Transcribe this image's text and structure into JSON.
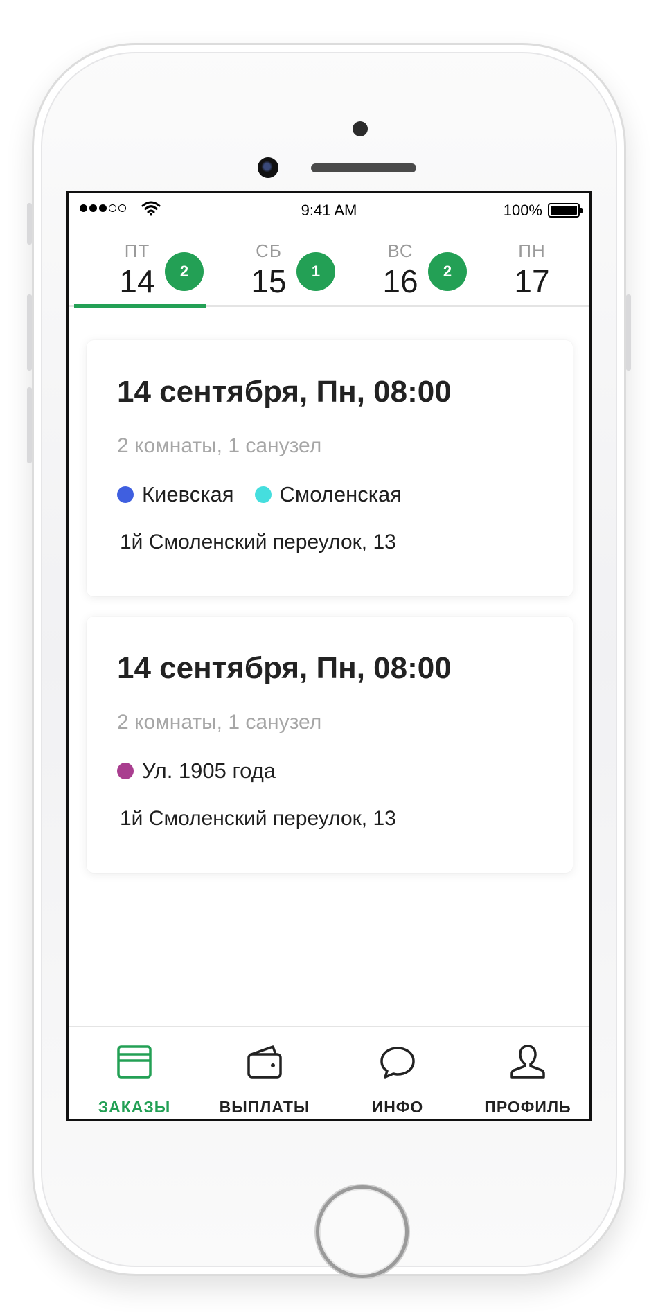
{
  "status_bar": {
    "time": "9:41 AM",
    "battery_percent": "100%",
    "signal_bars": 3,
    "signal_total": 5
  },
  "days": [
    {
      "dow": "ПТ",
      "num": "14",
      "badge": "2",
      "selected": true
    },
    {
      "dow": "СБ",
      "num": "15",
      "badge": "1",
      "selected": false
    },
    {
      "dow": "ВС",
      "num": "16",
      "badge": "2",
      "selected": false
    },
    {
      "dow": "ПН",
      "num": "17",
      "badge": "",
      "selected": false
    }
  ],
  "orders": [
    {
      "title": "14 сентября, Пн, 08:00",
      "rooms": "2 комнаты, 1 санузел",
      "metros": [
        {
          "name": "Киевская",
          "color": "#3f5fe0"
        },
        {
          "name": "Смоленская",
          "color": "#45dede"
        }
      ],
      "address": "1й Смоленский переулок, 13"
    },
    {
      "title": "14 сентября, Пн, 08:00",
      "rooms": "2 комнаты, 1 санузел",
      "metros": [
        {
          "name": "Ул. 1905 года",
          "color": "#a93e8f"
        }
      ],
      "address": "1й Смоленский переулок, 13"
    }
  ],
  "tabbar": [
    {
      "label": "ЗАКАЗЫ",
      "icon": "orders-card-icon",
      "active": true
    },
    {
      "label": "ВЫПЛАТЫ",
      "icon": "wallet-icon",
      "active": false
    },
    {
      "label": "ИНФО",
      "icon": "chat-bubble-icon",
      "active": false
    },
    {
      "label": "ПРОФИЛЬ",
      "icon": "profile-icon",
      "active": false
    }
  ],
  "colors": {
    "accent": "#23a055",
    "text_primary": "#222222",
    "text_secondary": "#a6a6a6"
  }
}
